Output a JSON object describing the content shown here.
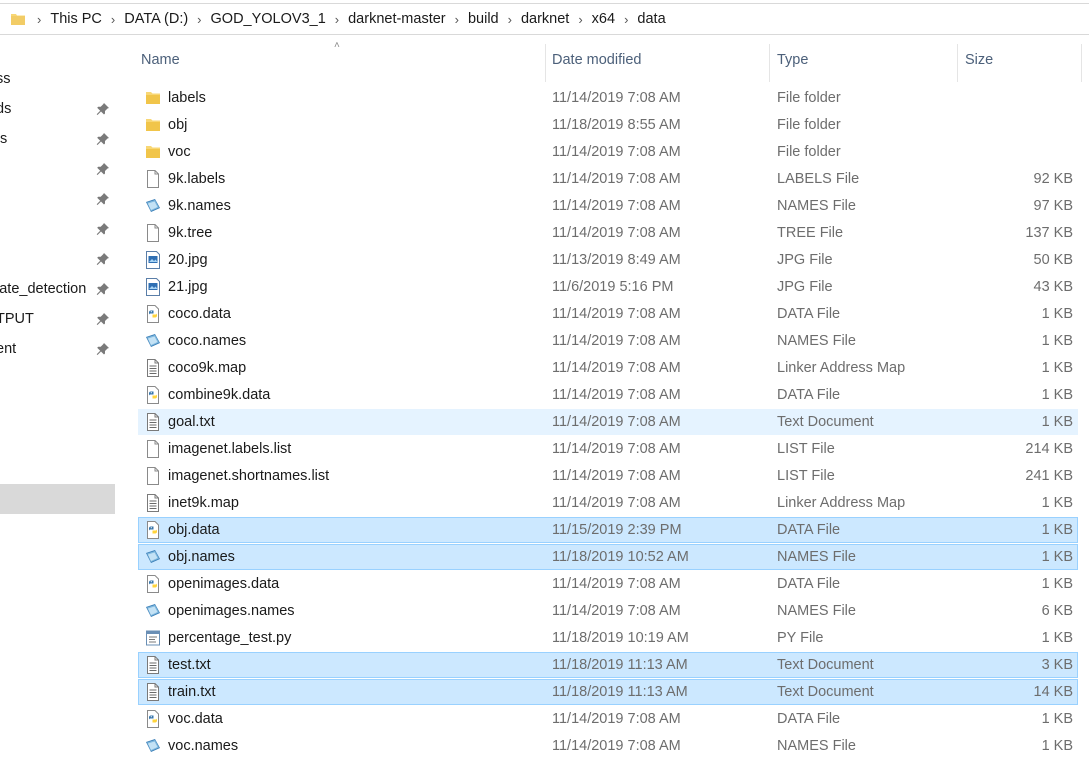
{
  "breadcrumb": [
    "This PC",
    "DATA (D:)",
    "GOD_YOLOV3_1",
    "darknet-master",
    "build",
    "darknet",
    "x64",
    "data"
  ],
  "sidebar": {
    "items": [
      {
        "label": "ss",
        "pinned": false
      },
      {
        "label": "ds",
        "pinned": true
      },
      {
        "label": "ts",
        "pinned": true
      },
      {
        "label": "",
        "pinned": true
      },
      {
        "label": "",
        "pinned": true
      },
      {
        "label": "",
        "pinned": true
      },
      {
        "label": "",
        "pinned": true
      },
      {
        "label": "late_detection",
        "pinned": true
      },
      {
        "label": "TPUT",
        "pinned": true
      },
      {
        "label": "ent",
        "pinned": true
      }
    ]
  },
  "columns": {
    "name": "Name",
    "date": "Date modified",
    "type": "Type",
    "size": "Size"
  },
  "files": [
    {
      "name": "labels",
      "date": "11/14/2019 7:08 AM",
      "type": "File folder",
      "size": "",
      "icon": "folder-icon",
      "state": ""
    },
    {
      "name": "obj",
      "date": "11/18/2019 8:55 AM",
      "type": "File folder",
      "size": "",
      "icon": "folder-icon",
      "state": ""
    },
    {
      "name": "voc",
      "date": "11/14/2019 7:08 AM",
      "type": "File folder",
      "size": "",
      "icon": "folder-icon",
      "state": ""
    },
    {
      "name": "9k.labels",
      "date": "11/14/2019 7:08 AM",
      "type": "LABELS File",
      "size": "92 KB",
      "icon": "blank-file-icon",
      "state": ""
    },
    {
      "name": "9k.names",
      "date": "11/14/2019 7:08 AM",
      "type": "NAMES File",
      "size": "97 KB",
      "icon": "names-file-icon",
      "state": ""
    },
    {
      "name": "9k.tree",
      "date": "11/14/2019 7:08 AM",
      "type": "TREE File",
      "size": "137 KB",
      "icon": "blank-file-icon",
      "state": ""
    },
    {
      "name": "20.jpg",
      "date": "11/13/2019 8:49 AM",
      "type": "JPG File",
      "size": "50 KB",
      "icon": "image-file-icon",
      "state": ""
    },
    {
      "name": "21.jpg",
      "date": "11/6/2019 5:16 PM",
      "type": "JPG File",
      "size": "43 KB",
      "icon": "image-file-icon",
      "state": ""
    },
    {
      "name": "coco.data",
      "date": "11/14/2019 7:08 AM",
      "type": "DATA File",
      "size": "1 KB",
      "icon": "python-file-icon",
      "state": ""
    },
    {
      "name": "coco.names",
      "date": "11/14/2019 7:08 AM",
      "type": "NAMES File",
      "size": "1 KB",
      "icon": "names-file-icon",
      "state": ""
    },
    {
      "name": "coco9k.map",
      "date": "11/14/2019 7:08 AM",
      "type": "Linker Address Map",
      "size": "1 KB",
      "icon": "text-file-icon",
      "state": ""
    },
    {
      "name": "combine9k.data",
      "date": "11/14/2019 7:08 AM",
      "type": "DATA File",
      "size": "1 KB",
      "icon": "python-file-icon",
      "state": ""
    },
    {
      "name": "goal.txt",
      "date": "11/14/2019 7:08 AM",
      "type": "Text Document",
      "size": "1 KB",
      "icon": "text-file-icon",
      "state": "hover"
    },
    {
      "name": "imagenet.labels.list",
      "date": "11/14/2019 7:08 AM",
      "type": "LIST File",
      "size": "214 KB",
      "icon": "blank-file-icon",
      "state": ""
    },
    {
      "name": "imagenet.shortnames.list",
      "date": "11/14/2019 7:08 AM",
      "type": "LIST File",
      "size": "241 KB",
      "icon": "blank-file-icon",
      "state": ""
    },
    {
      "name": "inet9k.map",
      "date": "11/14/2019 7:08 AM",
      "type": "Linker Address Map",
      "size": "1 KB",
      "icon": "text-file-icon",
      "state": ""
    },
    {
      "name": "obj.data",
      "date": "11/15/2019 2:39 PM",
      "type": "DATA File",
      "size": "1 KB",
      "icon": "python-file-icon",
      "state": "selected"
    },
    {
      "name": "obj.names",
      "date": "11/18/2019 10:52 AM",
      "type": "NAMES File",
      "size": "1 KB",
      "icon": "names-file-icon",
      "state": "selected"
    },
    {
      "name": "openimages.data",
      "date": "11/14/2019 7:08 AM",
      "type": "DATA File",
      "size": "1 KB",
      "icon": "python-file-icon",
      "state": ""
    },
    {
      "name": "openimages.names",
      "date": "11/14/2019 7:08 AM",
      "type": "NAMES File",
      "size": "6 KB",
      "icon": "names-file-icon",
      "state": ""
    },
    {
      "name": "percentage_test.py",
      "date": "11/18/2019 10:19 AM",
      "type": "PY File",
      "size": "1 KB",
      "icon": "py-script-icon",
      "state": ""
    },
    {
      "name": "test.txt",
      "date": "11/18/2019 11:13 AM",
      "type": "Text Document",
      "size": "3 KB",
      "icon": "text-file-icon",
      "state": "selected"
    },
    {
      "name": "train.txt",
      "date": "11/18/2019 11:13 AM",
      "type": "Text Document",
      "size": "14 KB",
      "icon": "text-file-icon",
      "state": "selected"
    },
    {
      "name": "voc.data",
      "date": "11/14/2019 7:08 AM",
      "type": "DATA File",
      "size": "1 KB",
      "icon": "python-file-icon",
      "state": ""
    },
    {
      "name": "voc.names",
      "date": "11/14/2019 7:08 AM",
      "type": "NAMES File",
      "size": "1 KB",
      "icon": "names-file-icon",
      "state": ""
    }
  ],
  "colors": {
    "selected_bg": "#cce8ff",
    "hover_bg": "#e5f3ff",
    "folder": "#f8d775",
    "header_text": "#4c607a"
  }
}
